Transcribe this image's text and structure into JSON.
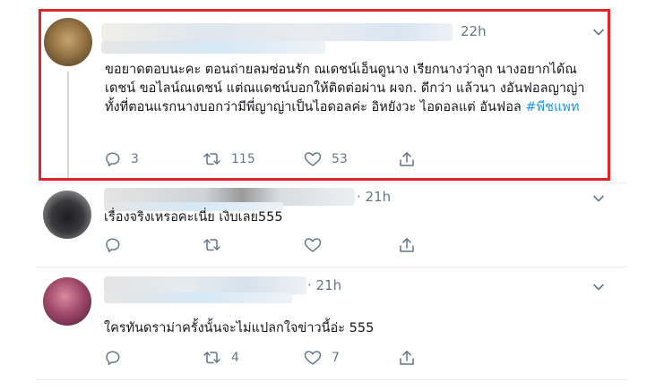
{
  "tweets": [
    {
      "time": "22h",
      "text_main": "ขอยาดตอบนะคะ ตอนถ่ายลมซ่อนรัก ณเดชน์เอ็นดูนาง เรียกนางว่าลูก นางอยากได้ณ เดชน์ ขอไลน์ณเดชน์ แต่ณแดชน์บอกให้ติดต่อผ่าน ผจก. ดีกว่า แล้วนา งอันฟอลญาญ่า ทั้งที่ตอนแรกนางบอกว่ามีพี่ญาญ่าเป็นไอดอลค่ะ อิหยังวะ ไอดอลแต่ อันฟอล",
      "hashtag": "#พีชแพท",
      "replies": "3",
      "retweets": "115",
      "likes": "53",
      "highlighted": true
    },
    {
      "time": "· 21h",
      "text_main": "เรื่องจริงเหรอคะเนี่ย เงิบเลย555",
      "replies": "",
      "retweets": "",
      "likes": ""
    },
    {
      "time": "· 21h",
      "text_main": "ใครทันดราม่าครั้งนั้นจะไม่แปลกใจข่าวนี้อ่ะ 555",
      "replies": "",
      "retweets": "4",
      "likes": "7"
    }
  ],
  "icons": {
    "reply": "reply-icon",
    "retweet": "retweet-icon",
    "like": "heart-icon",
    "share": "share-icon",
    "more": "chevron-down-icon"
  },
  "colors": {
    "highlight_border": "#e0252a",
    "hashtag": "#1b95e0",
    "muted": "#657786"
  }
}
